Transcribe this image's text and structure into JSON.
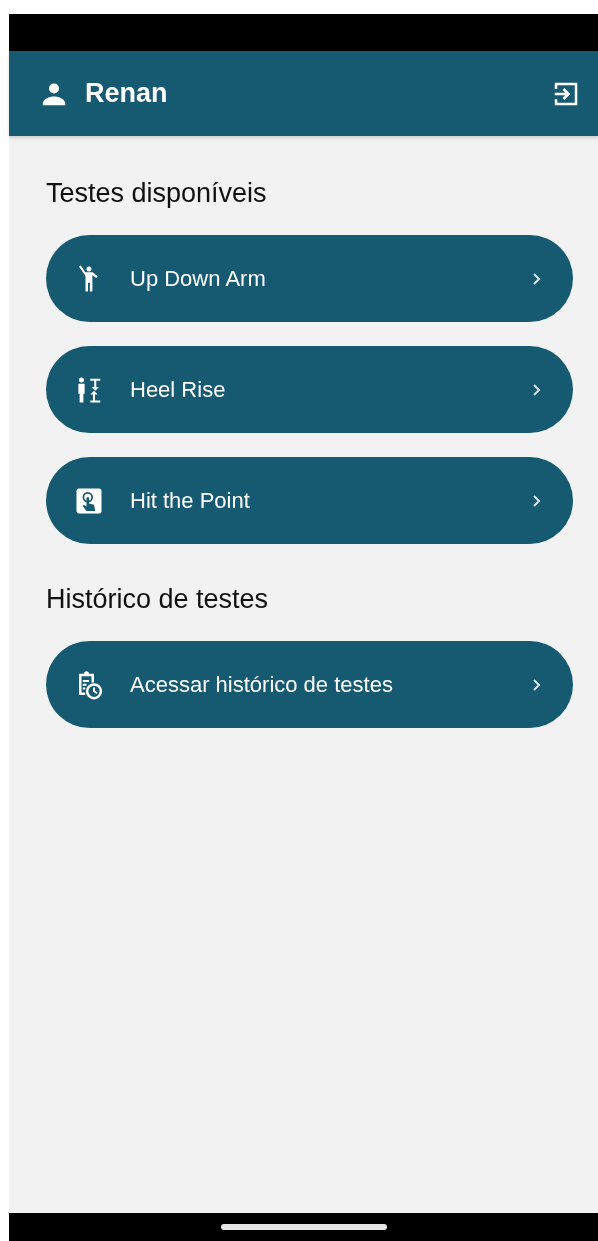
{
  "header": {
    "user_name": "Renan"
  },
  "sections": [
    {
      "title": "Testes disponíveis",
      "items": [
        {
          "label": "Up Down Arm",
          "kind": "arm"
        },
        {
          "label": "Heel Rise",
          "kind": "height"
        },
        {
          "label": "Hit the Point",
          "kind": "touch"
        }
      ]
    },
    {
      "title": "Histórico de testes",
      "items": [
        {
          "label": "Acessar histórico de testes",
          "kind": "history"
        }
      ]
    }
  ]
}
